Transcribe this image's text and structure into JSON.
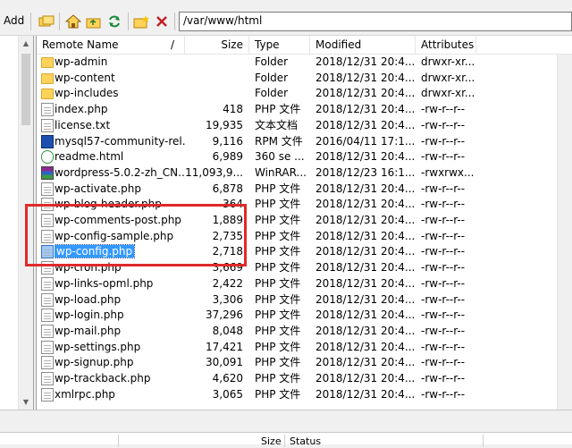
{
  "toolbar": {
    "add_label": "Add",
    "path_value": "/var/www/html"
  },
  "columns": {
    "name": "Remote Name",
    "slash": "/",
    "size": "Size",
    "type": "Type",
    "modified": "Modified",
    "attributes": "Attributes"
  },
  "files": [
    {
      "name": "wp-admin",
      "size": "",
      "type": "Folder",
      "modified": "2018/12/31 20:4...",
      "attr": "drwxr-xr...",
      "icon": "folder-icon"
    },
    {
      "name": "wp-content",
      "size": "",
      "type": "Folder",
      "modified": "2018/12/31 20:4...",
      "attr": "drwxr-xr...",
      "icon": "folder-icon"
    },
    {
      "name": "wp-includes",
      "size": "",
      "type": "Folder",
      "modified": "2018/12/31 20:4...",
      "attr": "drwxr-xr...",
      "icon": "folder-icon"
    },
    {
      "name": "index.php",
      "size": "418",
      "type": "PHP 文件",
      "modified": "2018/12/31 20:4...",
      "attr": "-rw-r--r--",
      "icon": "php-file-icon"
    },
    {
      "name": "license.txt",
      "size": "19,935",
      "type": "文本文档",
      "modified": "2018/12/31 20:4...",
      "attr": "-rw-r--r--",
      "icon": "text-file-icon"
    },
    {
      "name": "mysql57-community-rel...",
      "size": "9,116",
      "type": "RPM 文件",
      "modified": "2016/04/11 17:1...",
      "attr": "-rw-r--r--",
      "icon": "rpm-file-icon"
    },
    {
      "name": "readme.html",
      "size": "6,989",
      "type": "360 se ...",
      "modified": "2018/12/31 20:4...",
      "attr": "-rw-r--r--",
      "icon": "html-file-icon"
    },
    {
      "name": "wordpress-5.0.2-zh_CN....",
      "size": "11,093,9...",
      "type": "WinRAR...",
      "modified": "2018/12/23 16:1...",
      "attr": "-rwxrwx...",
      "icon": "rar-file-icon"
    },
    {
      "name": "wp-activate.php",
      "size": "6,878",
      "type": "PHP 文件",
      "modified": "2018/12/31 20:4...",
      "attr": "-rw-r--r--",
      "icon": "php-file-icon"
    },
    {
      "name": "wp-blog-header.php",
      "size": "364",
      "type": "PHP 文件",
      "modified": "2018/12/31 20:4...",
      "attr": "-rw-r--r--",
      "icon": "php-file-icon"
    },
    {
      "name": "wp-comments-post.php",
      "size": "1,889",
      "type": "PHP 文件",
      "modified": "2018/12/31 20:4...",
      "attr": "-rw-r--r--",
      "icon": "php-file-icon"
    },
    {
      "name": "wp-config-sample.php",
      "size": "2,735",
      "type": "PHP 文件",
      "modified": "2018/12/31 20:4...",
      "attr": "-rw-r--r--",
      "icon": "php-file-icon"
    },
    {
      "name": "wp-config.php",
      "size": "2,718",
      "type": "PHP 文件",
      "modified": "2018/12/31 20:4...",
      "attr": "-rw-r--r--",
      "icon": "php-file-icon",
      "selected": true
    },
    {
      "name": "wp-cron.php",
      "size": "3,669",
      "type": "PHP 文件",
      "modified": "2018/12/31 20:4...",
      "attr": "-rw-r--r--",
      "icon": "php-file-icon"
    },
    {
      "name": "wp-links-opml.php",
      "size": "2,422",
      "type": "PHP 文件",
      "modified": "2018/12/31 20:4...",
      "attr": "-rw-r--r--",
      "icon": "php-file-icon"
    },
    {
      "name": "wp-load.php",
      "size": "3,306",
      "type": "PHP 文件",
      "modified": "2018/12/31 20:4...",
      "attr": "-rw-r--r--",
      "icon": "php-file-icon"
    },
    {
      "name": "wp-login.php",
      "size": "37,296",
      "type": "PHP 文件",
      "modified": "2018/12/31 20:4...",
      "attr": "-rw-r--r--",
      "icon": "php-file-icon"
    },
    {
      "name": "wp-mail.php",
      "size": "8,048",
      "type": "PHP 文件",
      "modified": "2018/12/31 20:4...",
      "attr": "-rw-r--r--",
      "icon": "php-file-icon"
    },
    {
      "name": "wp-settings.php",
      "size": "17,421",
      "type": "PHP 文件",
      "modified": "2018/12/31 20:4...",
      "attr": "-rw-r--r--",
      "icon": "php-file-icon"
    },
    {
      "name": "wp-signup.php",
      "size": "30,091",
      "type": "PHP 文件",
      "modified": "2018/12/31 20:4...",
      "attr": "-rw-r--r--",
      "icon": "php-file-icon"
    },
    {
      "name": "wp-trackback.php",
      "size": "4,620",
      "type": "PHP 文件",
      "modified": "2018/12/31 20:4...",
      "attr": "-rw-r--r--",
      "icon": "php-file-icon"
    },
    {
      "name": "xmlrpc.php",
      "size": "3,065",
      "type": "PHP 文件",
      "modified": "2018/12/31 20:4...",
      "attr": "-rw-r--r--",
      "icon": "php-file-icon"
    }
  ],
  "queue": {
    "size_label": "Size",
    "status_label": "Status"
  },
  "colors": {
    "highlight": "#e02a2a",
    "selection": "#3399ff"
  }
}
